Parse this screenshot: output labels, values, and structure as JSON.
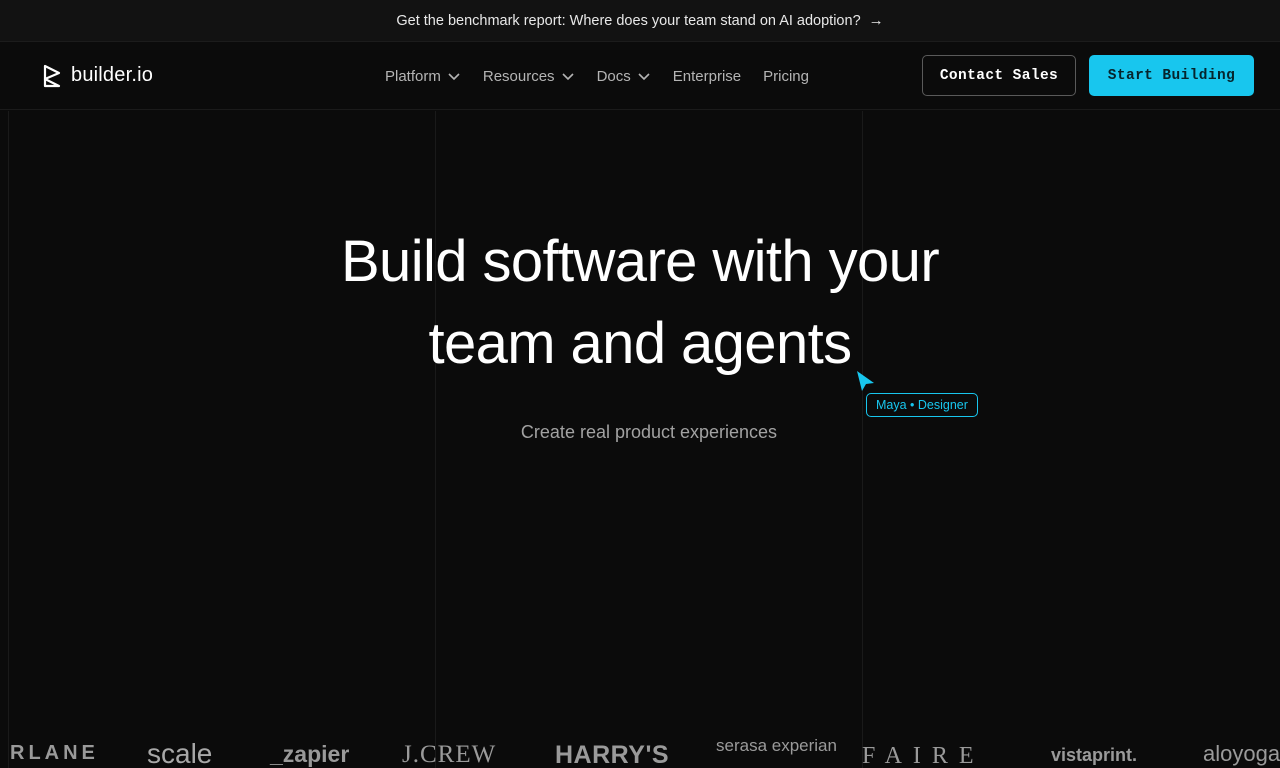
{
  "announcement": {
    "text": "Get the benchmark report: Where does your team stand on AI adoption?",
    "arrow_icon": "arrow-right-icon"
  },
  "nav": {
    "logo_text": "builder.io",
    "menu": [
      {
        "label": "Platform",
        "dropdown": true
      },
      {
        "label": "Resources",
        "dropdown": true
      },
      {
        "label": "Docs",
        "dropdown": true
      },
      {
        "label": "Enterprise",
        "dropdown": false
      },
      {
        "label": "Pricing",
        "dropdown": false
      }
    ],
    "contact_label": "Contact Sales",
    "start_label": "Start Building"
  },
  "hero": {
    "headline_line1": "Build software with your",
    "headline_line2": "team and agents",
    "subheadline": "Create real product experiences",
    "cursor_tag": "Maya • Designer"
  },
  "logos": {
    "rlane": "RLANE",
    "scale": "scale",
    "zapier": "_zapier",
    "jcrew": "J.CREW",
    "harrys": "HARRY'S",
    "serasa": "serasa experian",
    "faire": "FAIRE",
    "vistaprint": "vistaprint.",
    "alo": "aloyoga"
  },
  "colors": {
    "background": "#0b0b0b",
    "accent": "#18c6ee",
    "text_muted": "#a2a2a2"
  }
}
